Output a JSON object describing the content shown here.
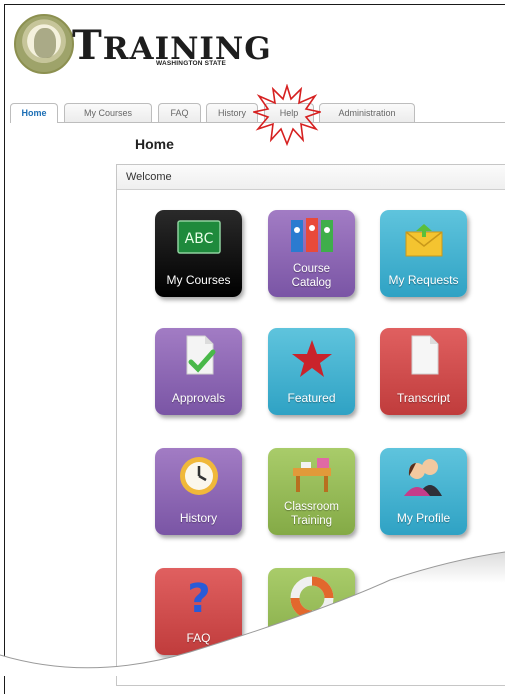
{
  "logo": {
    "letter": "T",
    "wordmark": "RAINING",
    "subtitle": "WASHINGTON STATE",
    "seal_icon": "state-seal-icon"
  },
  "tabs": [
    {
      "label": "Home",
      "active": true
    },
    {
      "label": "My Courses",
      "active": false
    },
    {
      "label": "FAQ",
      "active": false
    },
    {
      "label": "History",
      "active": false
    },
    {
      "label": "Help",
      "active": false
    },
    {
      "label": "Administration",
      "active": false
    }
  ],
  "page": {
    "title": "Home"
  },
  "panel": {
    "heading": "Welcome"
  },
  "tiles": [
    {
      "label": "My Courses",
      "icon": "chalkboard-icon",
      "color": "#000000"
    },
    {
      "label": "Course Catalog",
      "icon": "binders-icon",
      "color": "#8e68b6"
    },
    {
      "label": "My Requests",
      "icon": "envelope-icon",
      "color": "#3bb0d0"
    },
    {
      "label": "Approvals",
      "icon": "document-check-icon",
      "color": "#8e68b6"
    },
    {
      "label": "Featured",
      "icon": "star-icon",
      "color": "#3bb0d0"
    },
    {
      "label": "Transcript",
      "icon": "document-icon",
      "color": "#d04e4e"
    },
    {
      "label": "History",
      "icon": "clock-icon",
      "color": "#8e68b6"
    },
    {
      "label": "Classroom Training",
      "icon": "desk-icon",
      "color": "#98bb58"
    },
    {
      "label": "My Profile",
      "icon": "people-icon",
      "color": "#3bb0d0"
    },
    {
      "label": "FAQ",
      "icon": "question-mark-icon",
      "color": "#d04e4e"
    },
    {
      "label": "",
      "icon": "life-ring-icon",
      "color": "#98bb58"
    }
  ],
  "chalkboard_text": "ABC",
  "colors": {
    "active_tab": "#1d6fb5",
    "callout": "#d62020"
  }
}
